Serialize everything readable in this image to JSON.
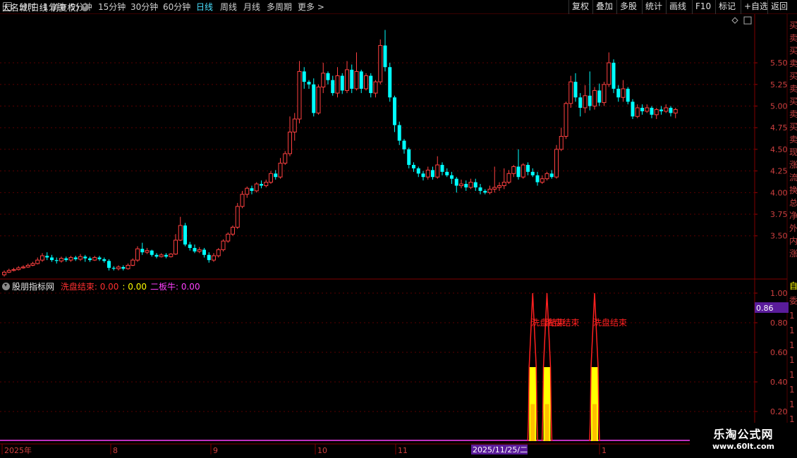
{
  "toolbar": {
    "periods": [
      "分时",
      "1分钟",
      "5分钟",
      "15分钟",
      "30分钟",
      "60分钟",
      "日线",
      "周线",
      "月线",
      "多周期",
      "更多 >"
    ],
    "active_period": "日线",
    "right_buttons": [
      "复权",
      "叠加",
      "多股",
      "统计",
      "画线",
      "F10",
      "标记",
      "+自选",
      "返回"
    ]
  },
  "main_chart": {
    "title": "大名城(日线 前复权)",
    "y_ticks": [
      "5.50",
      "5.25",
      "5.00",
      "4.75",
      "4.50",
      "4.25",
      "4.00",
      "3.75",
      "3.50"
    ]
  },
  "indicator": {
    "name": "股朋指标网",
    "items": [
      {
        "label": "洗盘结束: 0.00",
        "color": "#ff3030"
      },
      {
        "label": ": 0.00",
        "color": "#ffff00"
      },
      {
        "label": "二板牛: 0.00",
        "color": "#ff40ff"
      }
    ],
    "y_ticks": [
      "1.00",
      "0.80",
      "0.60",
      "0.40",
      "0.20"
    ],
    "cursor_value": "0.86",
    "signal_label": "洗盘结束"
  },
  "date_axis": {
    "labels": [
      "2025年",
      "8",
      "9",
      "10",
      "11",
      "1"
    ],
    "cursor_date": "2025/11/25/二"
  },
  "side_panel": {
    "top_chars": "买卖买卖买卖买卖买卖现涨流换总净外内涨",
    "bottom_chars": "自委1111111111"
  },
  "watermark": {
    "line1": "乐淘公式网",
    "line2": "www.60lt.com"
  },
  "colors": {
    "up": "#ff4040",
    "down": "#00ffff",
    "signal_line": "#ff2020",
    "signal_fill": "#ffff00"
  },
  "chart_data": {
    "type": "candlestick",
    "title": "大名城(日线 前复权)",
    "ylim": [
      3.05,
      5.9
    ],
    "candles": [
      [
        3.05,
        3.08,
        3.03,
        3.1
      ],
      [
        3.08,
        3.1,
        3.07,
        3.12
      ],
      [
        3.1,
        3.11,
        3.09,
        3.13
      ],
      [
        3.11,
        3.13,
        3.1,
        3.15
      ],
      [
        3.13,
        3.14,
        3.12,
        3.16
      ],
      [
        3.14,
        3.16,
        3.13,
        3.18
      ],
      [
        3.16,
        3.18,
        3.15,
        3.2
      ],
      [
        3.18,
        3.22,
        3.17,
        3.25
      ],
      [
        3.22,
        3.27,
        3.2,
        3.3
      ],
      [
        3.27,
        3.25,
        3.22,
        3.31
      ],
      [
        3.25,
        3.22,
        3.2,
        3.28
      ],
      [
        3.22,
        3.21,
        3.18,
        3.25
      ],
      [
        3.21,
        3.24,
        3.19,
        3.26
      ],
      [
        3.24,
        3.22,
        3.2,
        3.26
      ],
      [
        3.22,
        3.25,
        3.2,
        3.27
      ],
      [
        3.25,
        3.23,
        3.21,
        3.27
      ],
      [
        3.23,
        3.26,
        3.21,
        3.29
      ],
      [
        3.26,
        3.24,
        3.2,
        3.28
      ],
      [
        3.24,
        3.22,
        3.2,
        3.26
      ],
      [
        3.22,
        3.25,
        3.21,
        3.27
      ],
      [
        3.25,
        3.23,
        3.21,
        3.27
      ],
      [
        3.23,
        3.21,
        3.19,
        3.25
      ],
      [
        3.21,
        3.13,
        3.1,
        3.23
      ],
      [
        3.13,
        3.12,
        3.1,
        3.15
      ],
      [
        3.12,
        3.14,
        3.1,
        3.16
      ],
      [
        3.14,
        3.12,
        3.1,
        3.16
      ],
      [
        3.12,
        3.16,
        3.11,
        3.18
      ],
      [
        3.16,
        3.22,
        3.15,
        3.24
      ],
      [
        3.22,
        3.35,
        3.2,
        3.38
      ],
      [
        3.35,
        3.31,
        3.28,
        3.42
      ],
      [
        3.31,
        3.33,
        3.29,
        3.36
      ],
      [
        3.33,
        3.28,
        3.26,
        3.34
      ],
      [
        3.28,
        3.26,
        3.24,
        3.3
      ],
      [
        3.26,
        3.28,
        3.25,
        3.3
      ],
      [
        3.28,
        3.26,
        3.24,
        3.3
      ],
      [
        3.26,
        3.29,
        3.25,
        3.3
      ],
      [
        3.29,
        3.45,
        3.28,
        3.52
      ],
      [
        3.45,
        3.62,
        3.44,
        3.72
      ],
      [
        3.62,
        3.4,
        3.38,
        3.65
      ],
      [
        3.4,
        3.36,
        3.33,
        3.43
      ],
      [
        3.36,
        3.32,
        3.3,
        3.4
      ],
      [
        3.32,
        3.34,
        3.3,
        3.37
      ],
      [
        3.34,
        3.28,
        3.25,
        3.36
      ],
      [
        3.28,
        3.22,
        3.19,
        3.31
      ],
      [
        3.22,
        3.27,
        3.2,
        3.3
      ],
      [
        3.27,
        3.34,
        3.25,
        3.36
      ],
      [
        3.34,
        3.44,
        3.32,
        3.46
      ],
      [
        3.44,
        3.52,
        3.42,
        3.54
      ],
      [
        3.52,
        3.6,
        3.5,
        3.62
      ],
      [
        3.6,
        3.84,
        3.58,
        3.88
      ],
      [
        3.84,
        3.98,
        3.82,
        4.02
      ],
      [
        3.98,
        4.05,
        3.94,
        4.07
      ],
      [
        4.05,
        4.02,
        3.98,
        4.08
      ],
      [
        4.02,
        4.1,
        4.0,
        4.12
      ],
      [
        4.1,
        4.08,
        4.05,
        4.14
      ],
      [
        4.08,
        4.12,
        4.06,
        4.15
      ],
      [
        4.12,
        4.22,
        4.1,
        4.25
      ],
      [
        4.22,
        4.18,
        4.15,
        4.26
      ],
      [
        4.18,
        4.34,
        4.16,
        4.4
      ],
      [
        4.34,
        4.45,
        4.32,
        4.48
      ],
      [
        4.45,
        4.7,
        4.42,
        4.88
      ],
      [
        4.7,
        4.85,
        4.6,
        4.92
      ],
      [
        4.85,
        5.4,
        4.8,
        5.52
      ],
      [
        5.4,
        5.28,
        5.2,
        5.45
      ],
      [
        5.28,
        5.25,
        5.2,
        5.3
      ],
      [
        5.25,
        4.92,
        4.88,
        5.32
      ],
      [
        4.92,
        5.22,
        4.9,
        5.25
      ],
      [
        5.22,
        5.38,
        5.15,
        5.5
      ],
      [
        5.38,
        5.3,
        5.25,
        5.4
      ],
      [
        5.3,
        5.15,
        5.12,
        5.35
      ],
      [
        5.15,
        5.35,
        5.1,
        5.45
      ],
      [
        5.35,
        5.18,
        5.14,
        5.38
      ],
      [
        5.18,
        5.42,
        5.15,
        5.52
      ],
      [
        5.42,
        5.2,
        5.15,
        5.48
      ],
      [
        5.2,
        5.4,
        5.18,
        5.62
      ],
      [
        5.4,
        5.2,
        5.15,
        5.42
      ],
      [
        5.2,
        5.35,
        5.18,
        5.38
      ],
      [
        5.35,
        5.15,
        5.1,
        5.38
      ],
      [
        5.15,
        5.28,
        5.1,
        5.3
      ],
      [
        5.28,
        5.7,
        5.25,
        5.77
      ],
      [
        5.7,
        5.45,
        5.4,
        5.88
      ],
      [
        5.45,
        5.1,
        5.05,
        5.5
      ],
      [
        5.1,
        4.78,
        4.7,
        5.12
      ],
      [
        4.78,
        4.6,
        4.55,
        4.82
      ],
      [
        4.6,
        4.5,
        4.45,
        4.62
      ],
      [
        4.5,
        4.32,
        4.28,
        4.52
      ],
      [
        4.32,
        4.28,
        4.24,
        4.35
      ],
      [
        4.28,
        4.22,
        4.18,
        4.3
      ],
      [
        4.22,
        4.18,
        4.14,
        4.25
      ],
      [
        4.18,
        4.26,
        4.15,
        4.3
      ],
      [
        4.26,
        4.18,
        4.15,
        4.3
      ],
      [
        4.18,
        4.32,
        4.16,
        4.42
      ],
      [
        4.32,
        4.24,
        4.2,
        4.35
      ],
      [
        4.24,
        4.2,
        4.18,
        4.28
      ],
      [
        4.2,
        4.16,
        4.1,
        4.24
      ],
      [
        4.16,
        4.08,
        4.0,
        4.18
      ],
      [
        4.08,
        4.1,
        4.05,
        4.15
      ],
      [
        4.1,
        4.06,
        4.02,
        4.14
      ],
      [
        4.06,
        4.12,
        4.04,
        4.16
      ],
      [
        4.12,
        4.06,
        4.02,
        4.16
      ],
      [
        4.06,
        4.02,
        3.98,
        4.1
      ],
      [
        4.02,
        4.0,
        3.98,
        4.04
      ],
      [
        4.0,
        4.04,
        3.98,
        4.08
      ],
      [
        4.04,
        4.06,
        4.0,
        4.3
      ],
      [
        4.06,
        4.08,
        4.02,
        4.12
      ],
      [
        4.08,
        4.12,
        4.04,
        4.28
      ],
      [
        4.12,
        4.22,
        4.1,
        4.26
      ],
      [
        4.22,
        4.3,
        4.18,
        4.32
      ],
      [
        4.3,
        4.18,
        4.15,
        4.5
      ],
      [
        4.18,
        4.32,
        4.16,
        4.34
      ],
      [
        4.32,
        4.24,
        4.2,
        4.35
      ],
      [
        4.24,
        4.2,
        4.18,
        4.28
      ],
      [
        4.2,
        4.12,
        4.08,
        4.24
      ],
      [
        4.12,
        4.16,
        4.1,
        4.2
      ],
      [
        4.16,
        4.22,
        4.14,
        4.24
      ],
      [
        4.22,
        4.18,
        4.16,
        4.26
      ],
      [
        4.18,
        4.5,
        4.16,
        4.55
      ],
      [
        4.5,
        4.65,
        4.48,
        4.75
      ],
      [
        4.65,
        5.03,
        4.62,
        5.05
      ],
      [
        5.03,
        5.28,
        4.98,
        5.35
      ],
      [
        5.28,
        5.1,
        5.05,
        5.38
      ],
      [
        5.1,
        4.98,
        4.88,
        5.15
      ],
      [
        4.98,
        5.12,
        4.92,
        5.24
      ],
      [
        5.12,
        5.0,
        4.95,
        5.4
      ],
      [
        5.0,
        5.18,
        4.96,
        5.22
      ],
      [
        5.18,
        5.04,
        5.0,
        5.26
      ],
      [
        5.04,
        5.25,
        5.0,
        5.28
      ],
      [
        5.25,
        5.5,
        5.22,
        5.62
      ],
      [
        5.5,
        5.2,
        5.15,
        5.54
      ],
      [
        5.2,
        5.1,
        5.05,
        5.24
      ],
      [
        5.1,
        5.2,
        5.05,
        5.3
      ],
      [
        5.2,
        5.05,
        5.02,
        5.22
      ],
      [
        5.05,
        4.88,
        4.85,
        5.08
      ],
      [
        4.88,
        4.98,
        4.86,
        5.02
      ],
      [
        4.98,
        4.94,
        4.9,
        5.02
      ],
      [
        4.94,
        4.98,
        4.92,
        5.02
      ],
      [
        4.98,
        4.9,
        4.86,
        5.0
      ],
      [
        4.9,
        4.96,
        4.85,
        4.98
      ],
      [
        4.96,
        4.94,
        4.9,
        5.0
      ],
      [
        4.94,
        4.98,
        4.92,
        5.02
      ],
      [
        4.98,
        4.92,
        4.88,
        5.0
      ],
      [
        4.92,
        4.96,
        4.86,
        4.98
      ]
    ],
    "signals": [
      {
        "index": 111,
        "value": 1.0
      },
      {
        "index": 114,
        "value": 1.0
      },
      {
        "index": 124,
        "value": 1.0
      }
    ],
    "indicator_ylim": [
      0,
      1.0
    ]
  }
}
